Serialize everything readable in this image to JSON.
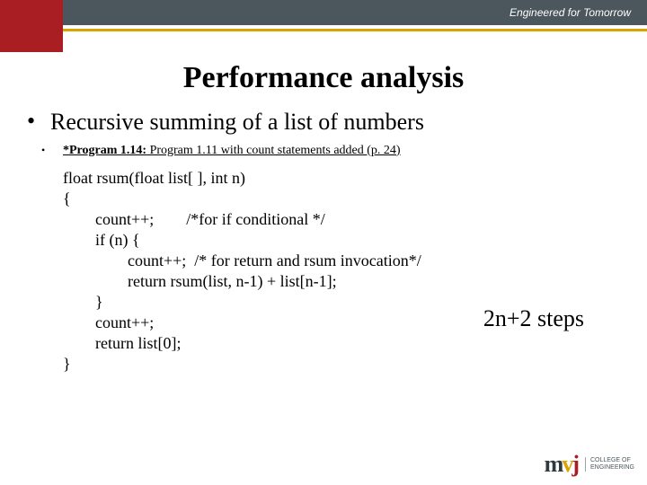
{
  "banner": {
    "tagline": "Engineered for Tomorrow"
  },
  "title": "Performance analysis",
  "bullet1": "Recursive summing of a list of numbers",
  "program": {
    "label": "*Program 1.14:",
    "rest": " Program 1.11 with count statements added (p. 24)"
  },
  "code": {
    "l1": "float rsum(float list[ ], int n)",
    "l2": "{",
    "l3": "        count++;        /*for if conditional */",
    "l4": "        if (n) {",
    "l5": "                count++;  /* for return and rsum invocation*/",
    "l6": "                return rsum(list, n-1) + list[n-1];",
    "l7": "        }",
    "l8": "        count++;",
    "l9": "        return list[0];",
    "l10": "}"
  },
  "steps": "2n+2 steps",
  "logo": {
    "m": "m",
    "v": "v",
    "j": "j",
    "line1": "COLLEGE OF",
    "line2": "ENGINEERING"
  }
}
